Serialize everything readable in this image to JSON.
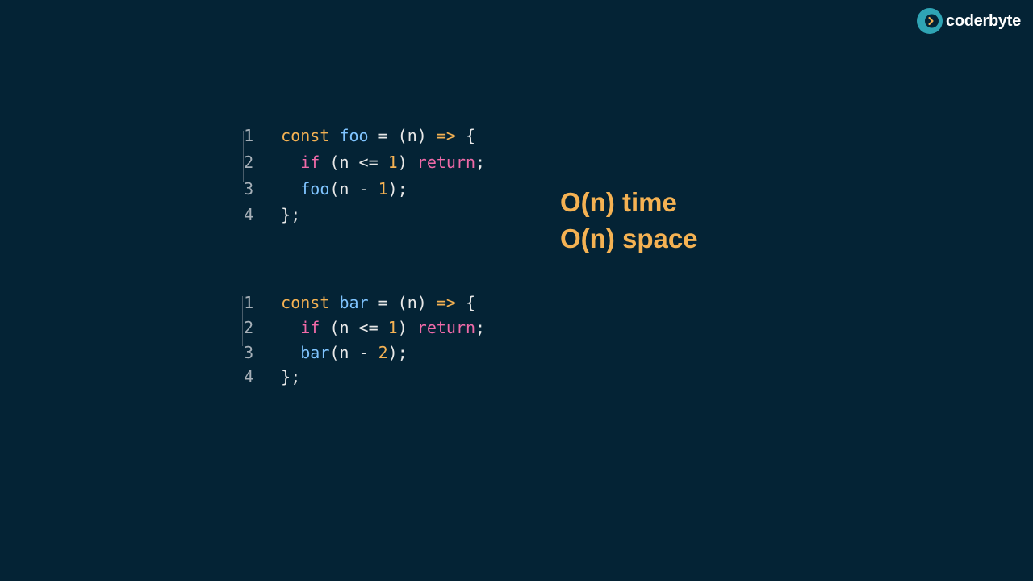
{
  "brand": {
    "name": "coderbyte",
    "icon": "coderbyte-logo-icon",
    "colors": {
      "icon": "#2fa4b4",
      "text": "#ffffff"
    }
  },
  "colors": {
    "background": "#042335",
    "keyword": "#f5b253",
    "function_name": "#7fc4ff",
    "control": "#f06aa8",
    "number": "#f5b253",
    "line_number": "#a7b0b8",
    "complexity": "#f5b253"
  },
  "code_blocks": [
    {
      "lines": [
        {
          "num": "1",
          "tokens": {
            "kw": "const",
            "s1": " ",
            "name": "foo",
            "s2": " = (n) ",
            "arrow": "=>",
            "s3": " {"
          }
        },
        {
          "num": "2",
          "tokens": {
            "if": "if",
            "s1": " (n <= ",
            "n": "1",
            "s2": ") ",
            "ret": "return",
            "s3": ";"
          }
        },
        {
          "num": "3",
          "tokens": {
            "name": "foo",
            "s1": "(n - ",
            "n": "1",
            "s2": ");"
          }
        },
        {
          "num": "4",
          "tokens": {
            "s1": "};"
          }
        }
      ]
    },
    {
      "lines": [
        {
          "num": "1",
          "tokens": {
            "kw": "const",
            "s1": " ",
            "name": "bar",
            "s2": " = (n) ",
            "arrow": "=>",
            "s3": " {"
          }
        },
        {
          "num": "2",
          "tokens": {
            "if": "if",
            "s1": " (n <= ",
            "n": "1",
            "s2": ") ",
            "ret": "return",
            "s3": ";"
          }
        },
        {
          "num": "3",
          "tokens": {
            "name": "bar",
            "s1": "(n - ",
            "n": "2",
            "s2": ");"
          }
        },
        {
          "num": "4",
          "tokens": {
            "s1": "};"
          }
        }
      ]
    }
  ],
  "complexity": {
    "time": "O(n) time",
    "space": "O(n) space"
  }
}
